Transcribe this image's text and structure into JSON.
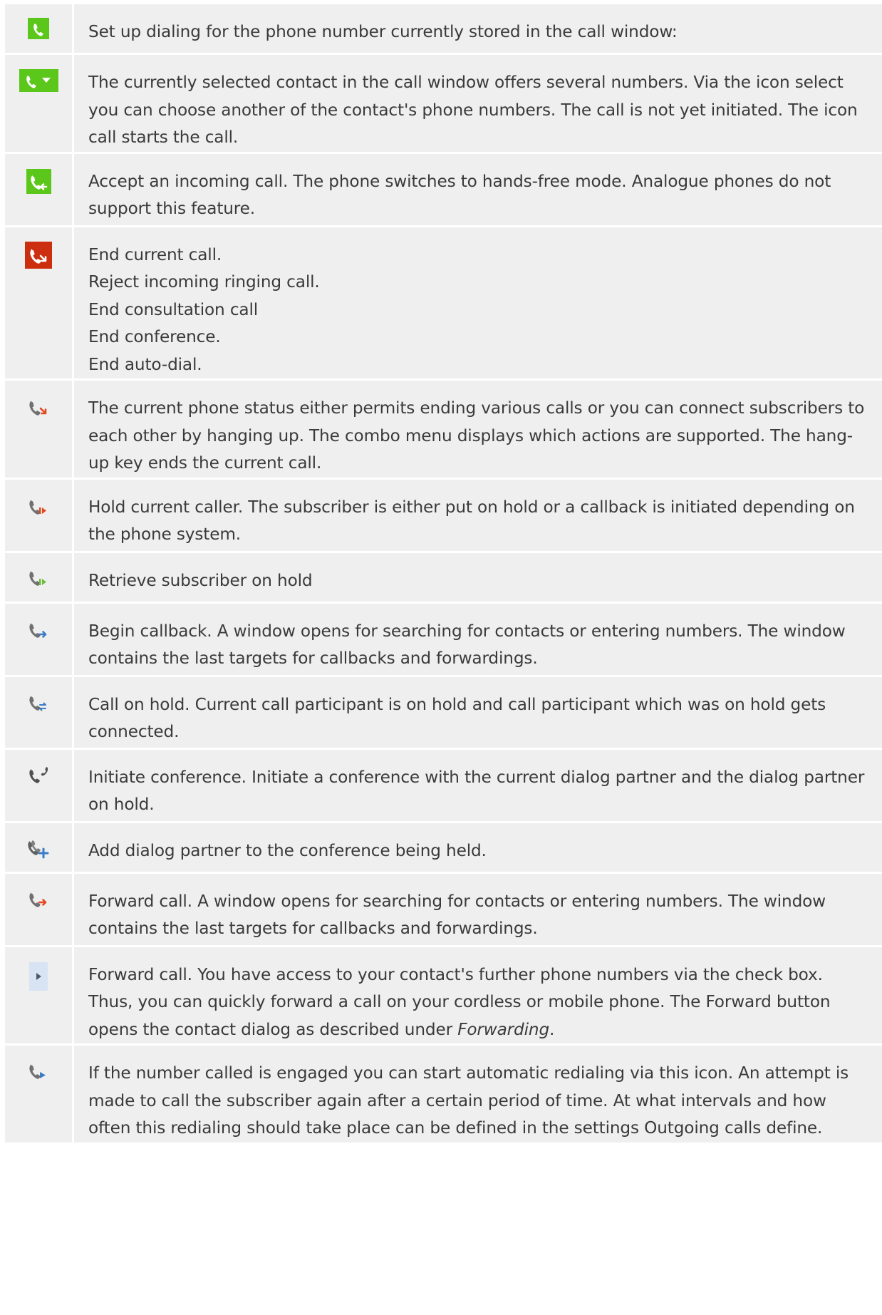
{
  "colors": {
    "row_background": "#efefef",
    "separator": "#ffffff",
    "text": "#3a3a3a",
    "green_icon": "#5cc71b",
    "red_icon": "#cc2f0f",
    "grey_handset": "#707070",
    "red_arrow": "#e34a1f",
    "green_arrow": "#6ebd3a",
    "blue_arrow": "#3a7cc6"
  },
  "rows": [
    {
      "icon": "dial-icon",
      "text": "Set up dialing for the phone number currently stored in the call window:"
    },
    {
      "icon": "dial-select-number-icon",
      "text": "The currently selected contact in the call window offers several numbers. Via the icon select you can choose another of the contact's phone numbers. The call is not yet initiated. The icon call starts the call."
    },
    {
      "icon": "accept-call-icon",
      "text": "Accept an incoming call. The phone switches to hands-free mode. Analogue phones do not support this feature."
    },
    {
      "icon": "end-call-icon",
      "lines": [
        "End current call.",
        "Reject incoming ringing call.",
        "End consultation call",
        "End conference.",
        "End auto-dial."
      ]
    },
    {
      "icon": "hang-up-options-icon",
      "text": "The current phone status either permits ending various calls or you can connect subscribers to each other by hanging up. The combo menu displays which actions are supported. The hang-up key ends the current call."
    },
    {
      "icon": "hold-call-icon",
      "text": "Hold current caller. The subscriber is either put on hold or a callback is initiated depending on the phone system."
    },
    {
      "icon": "retrieve-call-icon",
      "text": "Retrieve subscriber on hold"
    },
    {
      "icon": "callback-icon",
      "text": "Begin callback. A window opens for searching for contacts or entering numbers. The window contains the last targets for callbacks and forwardings."
    },
    {
      "icon": "swap-call-icon",
      "text": "Call on hold. Current call participant is on hold and call participant which was on hold gets connected."
    },
    {
      "icon": "conference-icon",
      "text": "Initiate conference. Initiate a conference with the current dialog partner and the dialog partner on hold."
    },
    {
      "icon": "add-to-conference-icon",
      "text": "Add dialog partner to the conference being held."
    },
    {
      "icon": "forward-call-icon",
      "text": "Forward call. A window opens for searching for contacts or entering numbers. The window contains the last targets for callbacks and forwardings."
    },
    {
      "icon": "forward-menu-icon",
      "text": "Forward call. You have access to your contact's further phone numbers via the check box. Thus, you can quickly forward a call on your cordless or mobile phone. The Forward button opens the contact dialog as described under ",
      "emphasis": "Forwarding",
      "suffix": "."
    },
    {
      "icon": "auto-redial-icon",
      "text": "If the number called is engaged you can start automatic redialing via this icon. An attempt is made to call the subscriber again after a certain period of time. At what intervals and how often this redialing should take place can be defined in the settings Outgoing calls define."
    }
  ]
}
